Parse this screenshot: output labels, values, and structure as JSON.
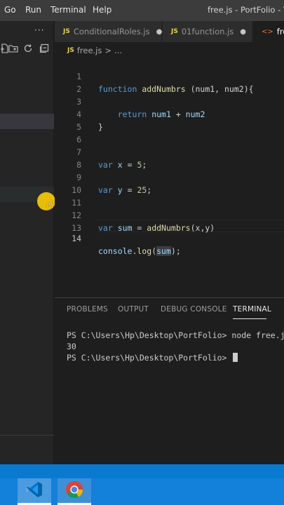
{
  "menu": {
    "items": [
      "Go",
      "Run",
      "Terminal",
      "Help"
    ],
    "window_title": "free.js - PortFolio - Vis"
  },
  "sidebar": {
    "more": "···"
  },
  "tabs": [
    {
      "label": "ConditionalRoles.js",
      "badge": "JS",
      "modified": "●"
    },
    {
      "label": "01function.js",
      "badge": "JS",
      "modified": "●"
    },
    {
      "label": "free",
      "badge": "<>"
    }
  ],
  "breadcrumb": {
    "badge": "JS",
    "file": "free.js",
    "sep": ">",
    "rest": "..."
  },
  "editor": {
    "line_numbers": [
      "1",
      "2",
      "3",
      "4",
      "5",
      "6",
      "7",
      "8",
      "9",
      "10",
      "11",
      "12",
      "13",
      "14"
    ],
    "lines": {
      "l1": {
        "kw": "function",
        "fn": "addNumbrs",
        "rest": " (num1, num2){"
      },
      "l3": {
        "kw": "return",
        "v1": "num1",
        "op": " + ",
        "v2": "num2"
      },
      "l4": "}",
      "l7": {
        "kw": "var",
        "v": "x",
        "op": " = ",
        "n": "5",
        "end": ";"
      },
      "l9": {
        "kw": "var",
        "v": "y",
        "op": " = ",
        "n": "25",
        "end": ";"
      },
      "l12": {
        "kw": "var",
        "v": "sum",
        "op": " = ",
        "fn": "addNumbrs",
        "args": "(x,y)"
      },
      "l14": {
        "obj": "console",
        "dot": ".",
        "fn": "log",
        "open": "(",
        "arg": "sum",
        "close": ");"
      }
    }
  },
  "panel": {
    "tabs": [
      "PROBLEMS",
      "OUTPUT",
      "DEBUG CONSOLE",
      "TERMINAL"
    ],
    "terminal": [
      "PS C:\\Users\\Hp\\Desktop\\PortFolio> node free.js",
      "30",
      "PS C:\\Users\\Hp\\Desktop\\PortFolio> "
    ]
  },
  "colors": {
    "accent": "#1380d9",
    "keyword": "#569cd6",
    "function": "#dcdcaa",
    "variable": "#9cdcfe",
    "number": "#b5cea8",
    "cursor_highlight": "#f3c500"
  }
}
